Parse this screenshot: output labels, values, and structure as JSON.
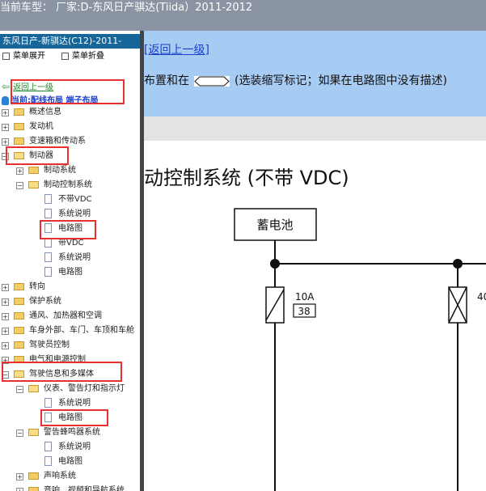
{
  "header": {
    "title": "当前车型： 厂家:D-东风日产骐达(Tiida）2011-2012"
  },
  "left_panel": {
    "title": "东风日产-新骐达(C12)-2011-",
    "expand_label": "菜单展开",
    "collapse_label": "菜单折叠",
    "back_label": "返回上一级",
    "current_label": "当前:配线布局 端子布局",
    "tree": [
      {
        "label": "概述信息"
      },
      {
        "label": "发动机"
      },
      {
        "label": "变速箱和传动系"
      },
      {
        "label": "制动器"
      },
      {
        "label": "制动系统"
      },
      {
        "label": "制动控制系统"
      },
      {
        "label": "不带VDC"
      },
      {
        "label": "系统说明"
      },
      {
        "label": "电路图"
      },
      {
        "label": "带VDC"
      },
      {
        "label": "系统说明"
      },
      {
        "label": "电路图"
      },
      {
        "label": "转向"
      },
      {
        "label": "保护系统"
      },
      {
        "label": "通风、加热器和空调"
      },
      {
        "label": "车身外部、车门、车顶和车舱"
      },
      {
        "label": "驾驶员控制"
      },
      {
        "label": "电气和电源控制"
      },
      {
        "label": "驾驶信息和多媒体"
      },
      {
        "label": "仪表、警告灯和指示灯"
      },
      {
        "label": "系统说明"
      },
      {
        "label": "电路图"
      },
      {
        "label": "警告蜂鸣器系统"
      },
      {
        "label": "系统说明"
      },
      {
        "label": "电路图"
      },
      {
        "label": "声响系统"
      },
      {
        "label": "音响、视频和导航系统"
      }
    ]
  },
  "content": {
    "return_link": "[返回上一级]",
    "desc_prefix": "布置和在",
    "desc_suffix": "(选装缩写标记；如果在电路图中没有描述)",
    "heading": "动控制系统 (不带 VDC)",
    "battery_label": "蓄电池",
    "fuse1_rating": "10A",
    "fuse1_number": "38",
    "fuse2_rating": "40"
  },
  "colors": {
    "highlight_red": "#e8302f",
    "panel_title_bg": "#17669a",
    "top_bar": "#8a94a2",
    "content_blue": "#a7ccf4"
  }
}
